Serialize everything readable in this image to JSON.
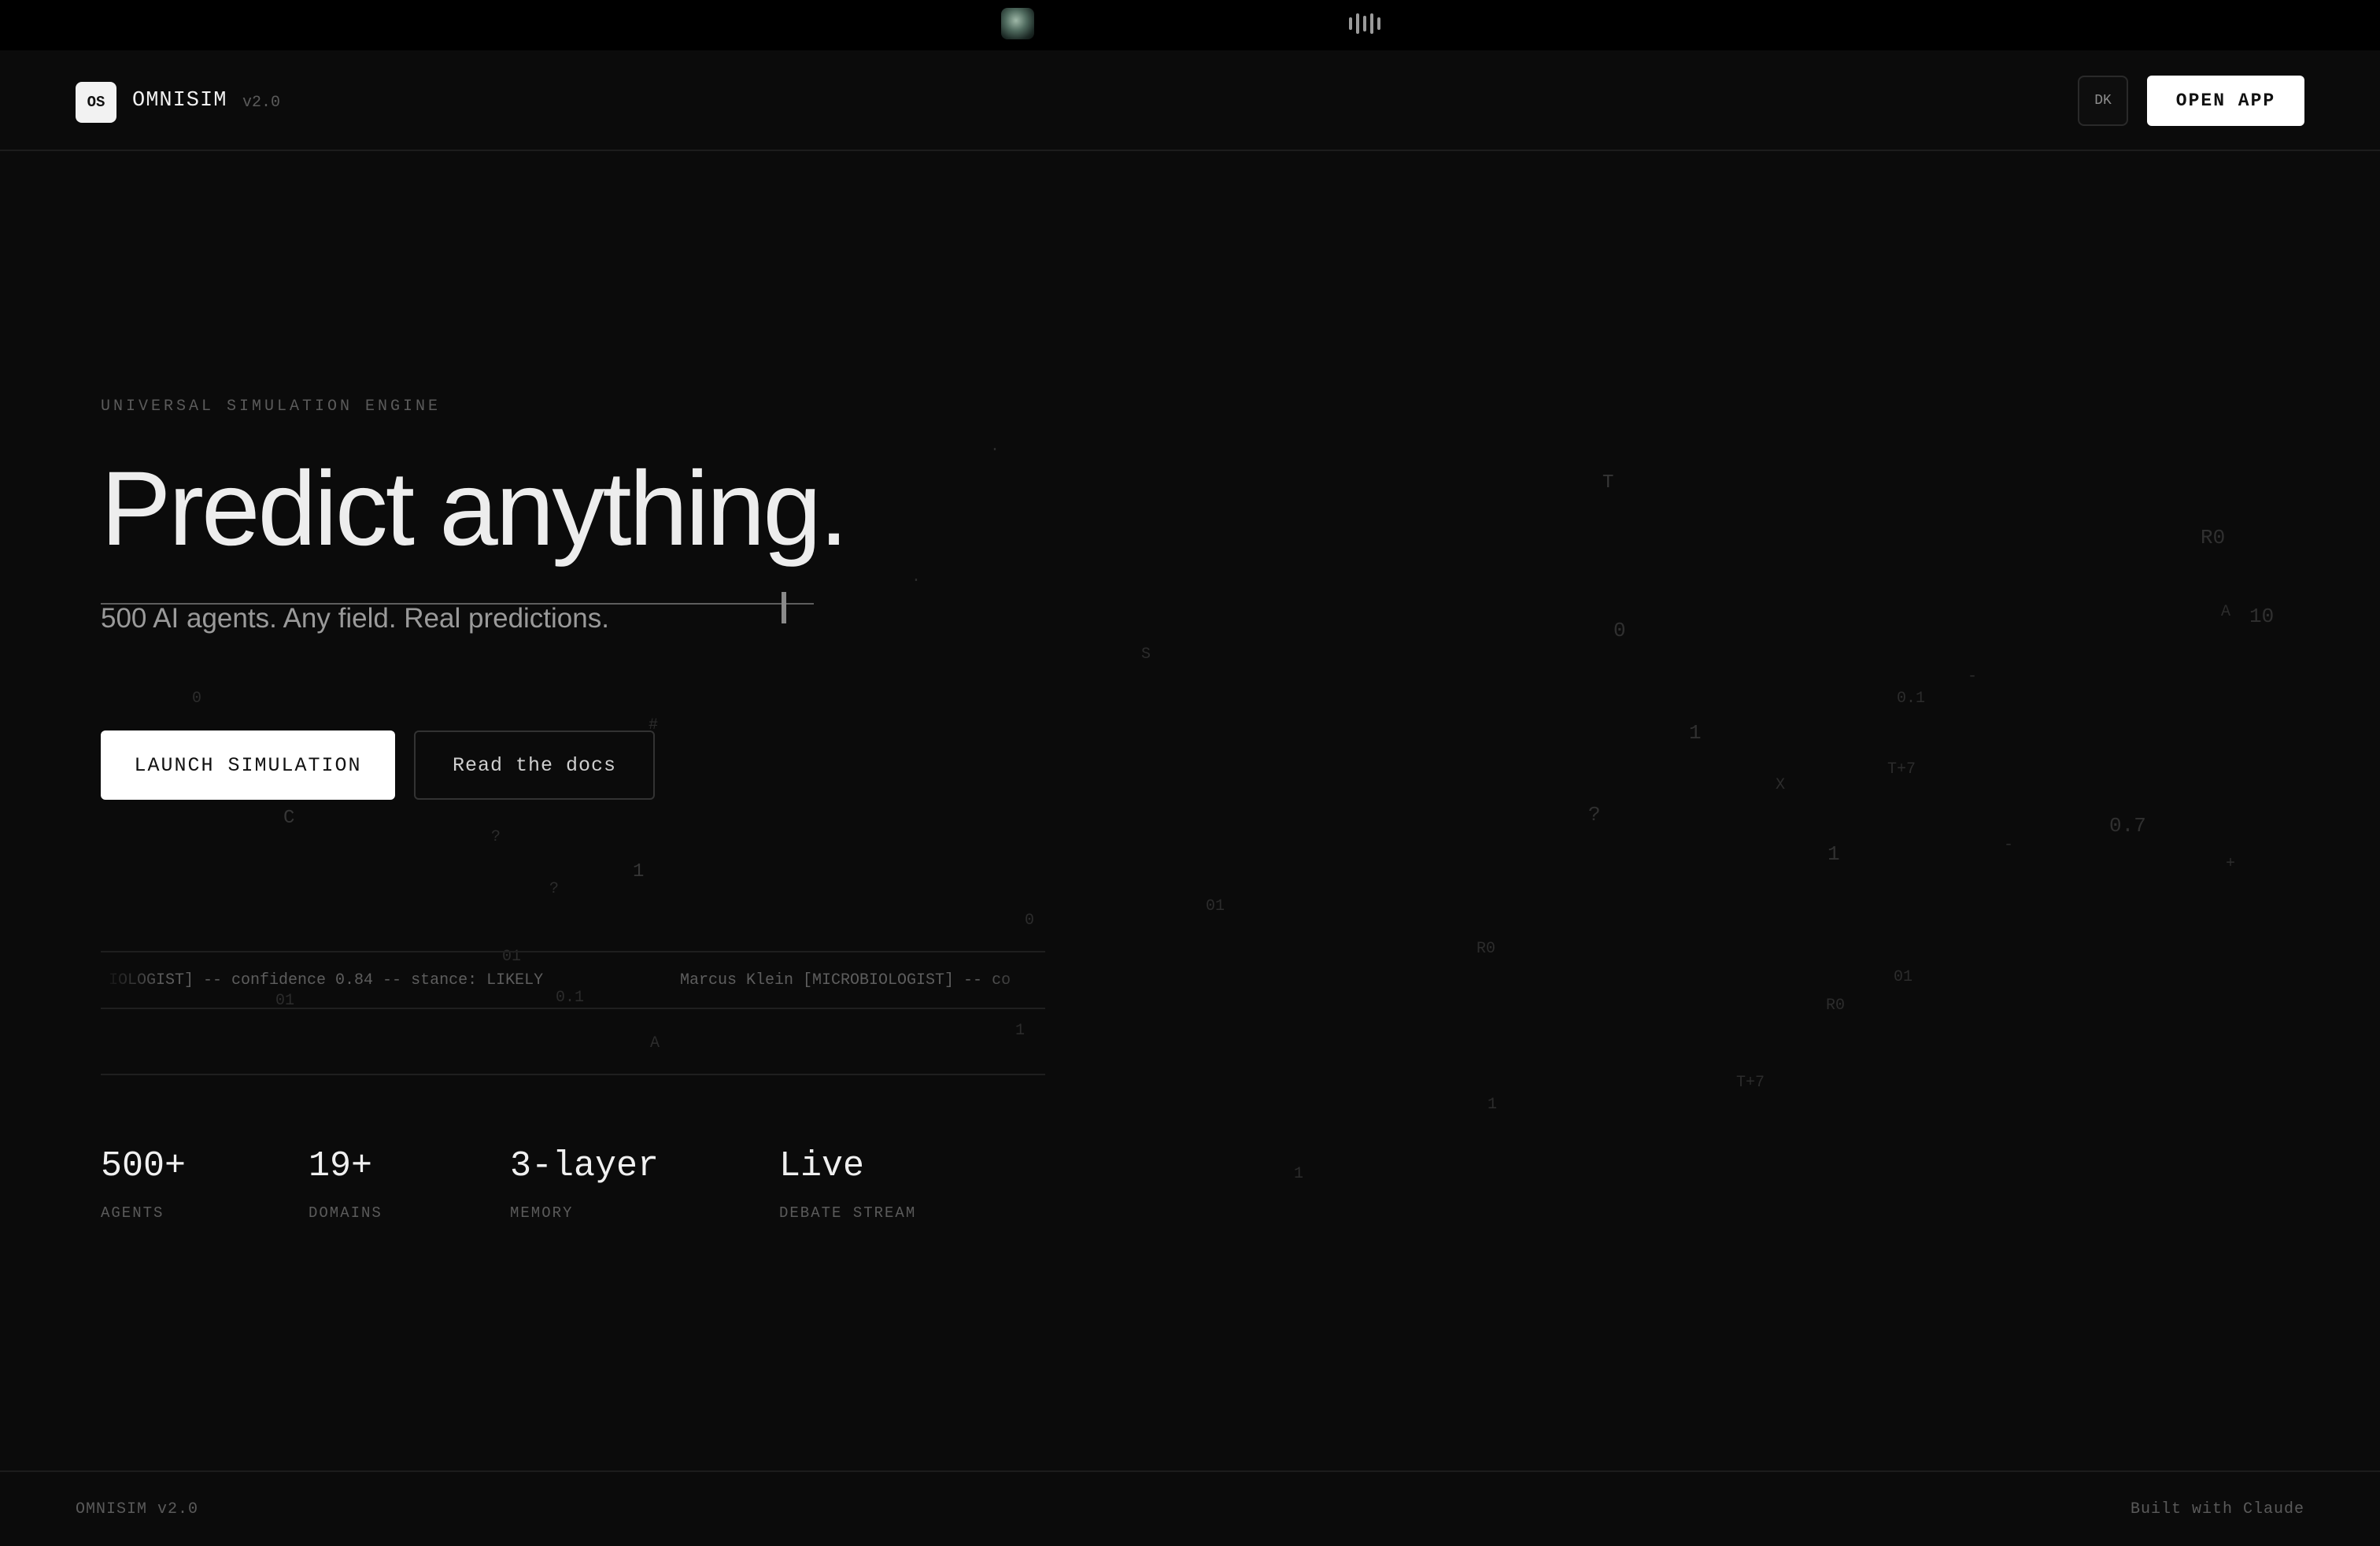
{
  "system_bar": {
    "icons": [
      "app-thumbnail-icon",
      "audio-bars-icon"
    ]
  },
  "header": {
    "logo_text": "OS",
    "brand": "OMNISIM",
    "version": "v2.0",
    "theme_toggle_label": "DK",
    "open_app_label": "OPEN APP"
  },
  "hero": {
    "eyebrow": "UNIVERSAL SIMULATION ENGINE",
    "headline": "Predict anything.",
    "subheadline": "500 AI agents. Any field. Real predictions.",
    "primary_cta": "LAUNCH SIMULATION",
    "secondary_cta": "Read the docs"
  },
  "debate_stream": [
    "IOLOGIST] -- confidence 0.84 -- stance: LIKELY",
    "Marcus Klein [MICROBIOLOGIST] -- co"
  ],
  "stats": [
    {
      "value": "500+",
      "label": "AGENTS"
    },
    {
      "value": "19+",
      "label": "DOMAINS"
    },
    {
      "value": "3-layer",
      "label": "MEMORY"
    },
    {
      "value": "Live",
      "label": "DEBATE STREAM"
    }
  ],
  "background_glyphs": [
    "T",
    "R0",
    "A",
    "10",
    "0",
    "0.1",
    "1",
    "T+7",
    "X",
    "?",
    "0.7",
    "1",
    "+",
    "01",
    "R0",
    "01",
    "R0",
    "T+7",
    "1",
    "1",
    "0",
    "#",
    "C",
    "?",
    "?",
    "1",
    "01",
    "0.1",
    "01",
    "A",
    "1",
    "0",
    "S",
    "-",
    "-",
    ".",
    "."
  ],
  "footer": {
    "left": "OMNISIM v2.0",
    "right": "Built with Claude"
  }
}
